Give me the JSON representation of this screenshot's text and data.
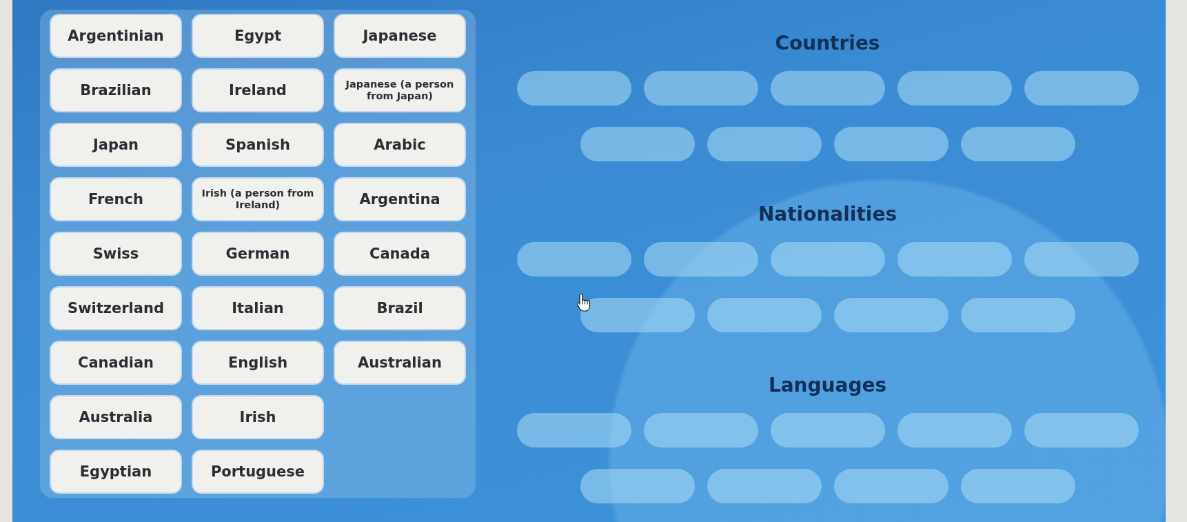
{
  "word_bank": {
    "rows": [
      [
        "Argentinian",
        "Egypt",
        "Japanese"
      ],
      [
        "Brazilian",
        "Ireland",
        "Japanese (a person from Japan)"
      ],
      [
        "Japan",
        "Spanish",
        "Arabic"
      ],
      [
        "French",
        "Irish (a person from Ireland)",
        "Argentina"
      ],
      [
        "Swiss",
        "German",
        "Canada"
      ],
      [
        "Switzerland",
        "Italian",
        "Brazil"
      ],
      [
        "Canadian",
        "English",
        "Australian"
      ],
      [
        "Australia",
        "Irish"
      ],
      [
        "Egyptian",
        "Portuguese"
      ]
    ]
  },
  "categories": [
    {
      "title": "Countries"
    },
    {
      "title": "Nationalities"
    },
    {
      "title": "Languages"
    }
  ]
}
